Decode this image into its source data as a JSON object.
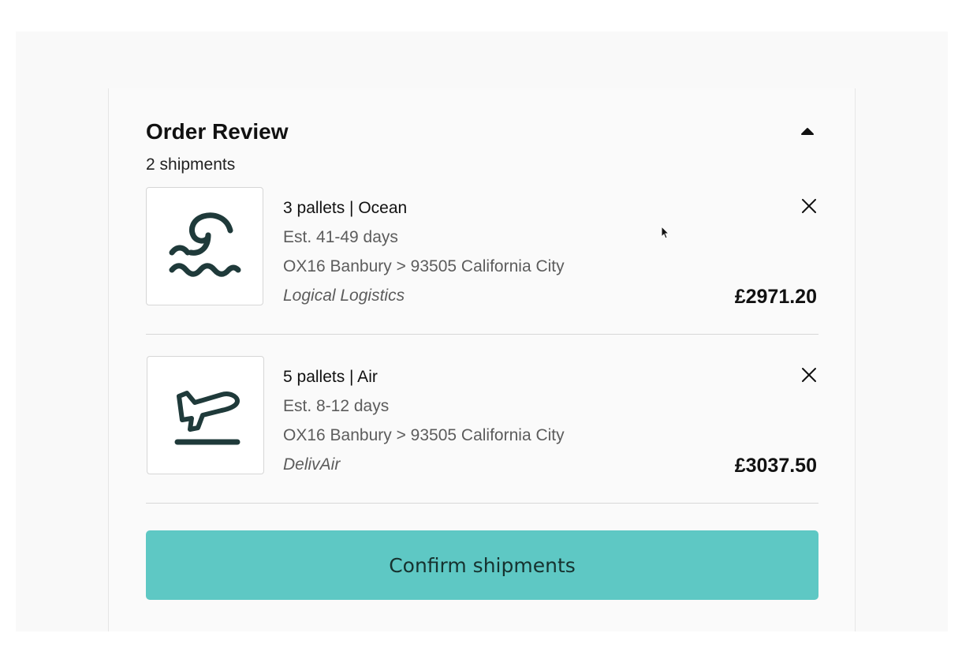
{
  "order_review": {
    "title": "Order Review",
    "subtitle": "2 shipments",
    "shipments": [
      {
        "summary": "3 pallets | Ocean",
        "estimate": "Est. 41-49 days",
        "route": "OX16 Banbury > 93505 California City",
        "carrier": "Logical Logistics",
        "price": "£2971.20",
        "icon": "ocean-wave-icon"
      },
      {
        "summary": "5 pallets | Air",
        "estimate": "Est. 8-12 days",
        "route": "OX16 Banbury > 93505 California City",
        "carrier": "DelivAir",
        "price": "£3037.50",
        "icon": "airplane-takeoff-icon"
      }
    ],
    "confirm_label": "Confirm shipments"
  },
  "colors": {
    "accent": "#5ec8c4",
    "icon": "#1f3a3a",
    "text": "#111111",
    "muted": "#5c5c5c"
  }
}
